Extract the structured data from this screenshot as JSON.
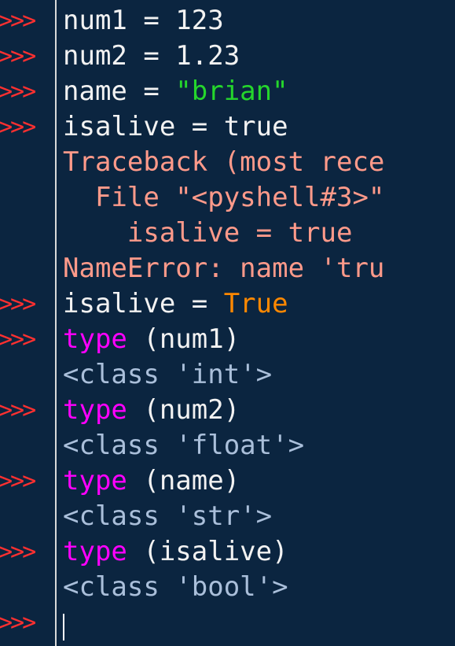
{
  "prompt_symbol": ">>>",
  "colors": {
    "background": "#0b2540",
    "prompt": "#ff3030",
    "plain": "#f2f2f2",
    "string": "#25d62c",
    "error": "#ff9a8a",
    "keyword": "#ff8800",
    "builtin": "#ff00ff",
    "output": "#aabfda"
  },
  "lines": [
    {
      "kind": "input",
      "parts": [
        {
          "text": "num1 = 123",
          "style": "plain"
        }
      ]
    },
    {
      "kind": "input",
      "parts": [
        {
          "text": "num2 = 1.23",
          "style": "plain"
        }
      ]
    },
    {
      "kind": "input",
      "parts": [
        {
          "text": "name = ",
          "style": "plain"
        },
        {
          "text": "\"brian\"",
          "style": "string"
        }
      ]
    },
    {
      "kind": "input",
      "parts": [
        {
          "text": "isalive = true",
          "style": "plain"
        }
      ]
    },
    {
      "kind": "output",
      "parts": [
        {
          "text": "Traceback (most rece",
          "style": "error"
        }
      ]
    },
    {
      "kind": "output",
      "parts": [
        {
          "text": "  File \"<pyshell#3>\"",
          "style": "error"
        }
      ]
    },
    {
      "kind": "output",
      "parts": [
        {
          "text": "    isalive = true",
          "style": "error"
        }
      ]
    },
    {
      "kind": "output",
      "parts": [
        {
          "text": "NameError: name 'tru",
          "style": "error"
        }
      ]
    },
    {
      "kind": "input",
      "parts": [
        {
          "text": "isalive = ",
          "style": "plain"
        },
        {
          "text": "True",
          "style": "keyword"
        }
      ]
    },
    {
      "kind": "input",
      "parts": [
        {
          "text": "type",
          "style": "builtin"
        },
        {
          "text": " (num1)",
          "style": "plain"
        }
      ]
    },
    {
      "kind": "output",
      "parts": [
        {
          "text": "<class 'int'>",
          "style": "output"
        }
      ]
    },
    {
      "kind": "input",
      "parts": [
        {
          "text": "type",
          "style": "builtin"
        },
        {
          "text": " (num2)",
          "style": "plain"
        }
      ]
    },
    {
      "kind": "output",
      "parts": [
        {
          "text": "<class 'float'>",
          "style": "output"
        }
      ]
    },
    {
      "kind": "input",
      "parts": [
        {
          "text": "type",
          "style": "builtin"
        },
        {
          "text": " (name)",
          "style": "plain"
        }
      ]
    },
    {
      "kind": "output",
      "parts": [
        {
          "text": "<class 'str'>",
          "style": "output"
        }
      ]
    },
    {
      "kind": "input",
      "parts": [
        {
          "text": "type",
          "style": "builtin"
        },
        {
          "text": " (isalive)",
          "style": "plain"
        }
      ]
    },
    {
      "kind": "output",
      "parts": [
        {
          "text": "<class 'bool'>",
          "style": "output"
        }
      ]
    },
    {
      "kind": "prompt",
      "parts": []
    }
  ]
}
